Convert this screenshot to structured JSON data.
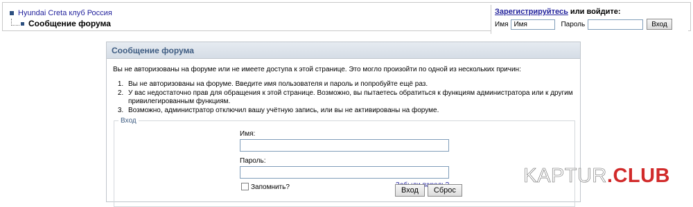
{
  "breadcrumb": {
    "forum_link": "Hyundai Creta клуб Россия",
    "current": "Сообщение форума"
  },
  "header_login": {
    "register_link": "Зарегистрируйтесь",
    "or_login": " или войдите:",
    "name_label": "Имя",
    "name_value": "Имя",
    "password_label": "Пароль",
    "password_value": "",
    "submit_label": "Вход"
  },
  "panel": {
    "title": "Сообщение форума",
    "intro": "Вы не авторизованы на форуме или не имеете доступа к этой странице. Это могло произойти по одной из нескольких причин:",
    "reasons": [
      "Вы не авторизованы на форуме. Введите имя пользователя и пароль и попробуйте ещё раз.",
      "У вас недостаточно прав для обращения к этой странице. Возможно, вы пытаетесь обратиться к функциям администратора или к другим привилегированным функциям.",
      "Возможно, администратор отключил вашу учётную запись, или вы не активированы на форуме."
    ]
  },
  "login_form": {
    "legend": "Вход",
    "username_label": "Имя:",
    "username_value": "",
    "password_label": "Пароль:",
    "password_value": "",
    "remember_label": "Запомнить?",
    "remember_checked": false,
    "forgot_link": "Забыли пароль?",
    "submit_label": "Вход",
    "reset_label": "Сброс"
  },
  "watermark": {
    "main": "KAPTUR",
    "suffix": ".CLUB"
  },
  "colors": {
    "panel_title": "#3e5c82",
    "link": "#22229c",
    "watermark_accent": "#d12a2a"
  }
}
